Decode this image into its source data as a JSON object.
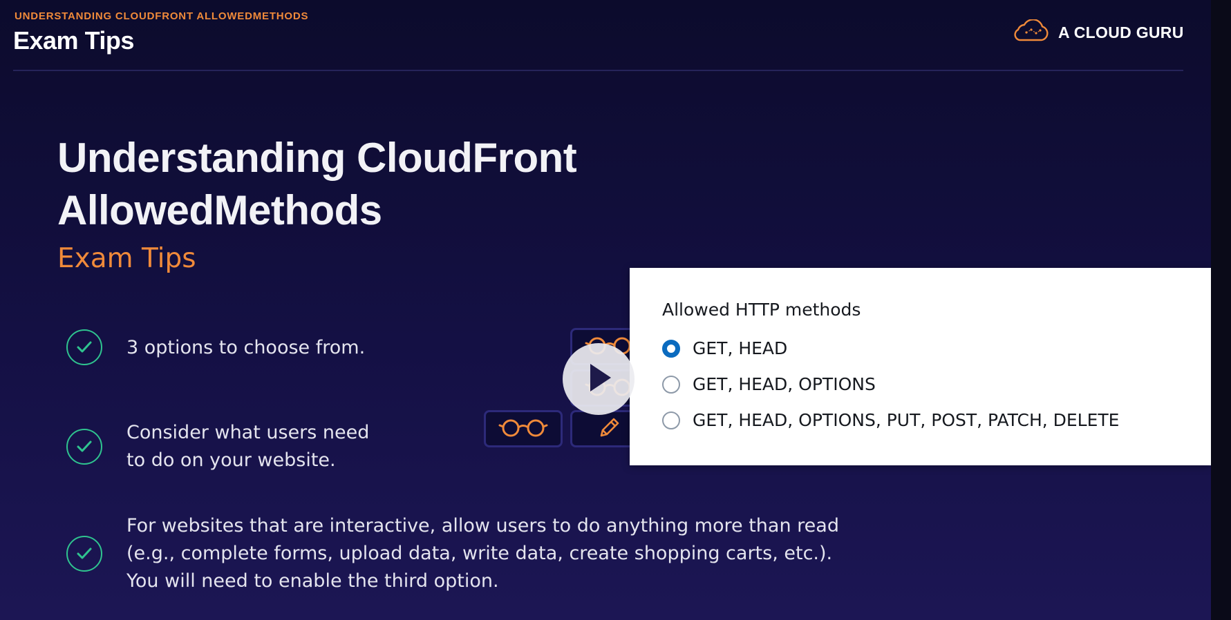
{
  "header": {
    "kicker": "UNDERSTANDING CLOUDFRONT ALLOWEDMETHODS",
    "title": "Exam Tips",
    "brand_name": "A CLOUD GURU"
  },
  "main": {
    "title_line1": "Understanding CloudFront",
    "title_line2": "AllowedMethods",
    "subtitle": "Exam Tips"
  },
  "tips": [
    {
      "lines": [
        "3 options to choose from."
      ]
    },
    {
      "lines": [
        "Consider what users need",
        "to do on your website."
      ]
    },
    {
      "lines": [
        "For websites that are interactive, allow users to do anything more than read",
        "(e.g., complete forms, upload data, write data, create shopping carts, etc.).",
        "You will need to enable the third option."
      ]
    }
  ],
  "methods_panel": {
    "label": "Allowed HTTP methods",
    "options": [
      {
        "label": "GET, HEAD",
        "selected": true
      },
      {
        "label": "GET, HEAD, OPTIONS",
        "selected": false
      },
      {
        "label": "GET, HEAD, OPTIONS, PUT, POST, PATCH, DELETE",
        "selected": false
      }
    ]
  },
  "icons": {
    "check": "check-circle-icon",
    "read": "glasses-icon",
    "write": "pencil-icon",
    "play": "play-icon",
    "brand": "cloud-logo-icon"
  },
  "colors": {
    "accent_orange": "#f08a3a",
    "check_green": "#2fc48f",
    "radio_blue": "#0b6bbf",
    "background": "#141044"
  }
}
